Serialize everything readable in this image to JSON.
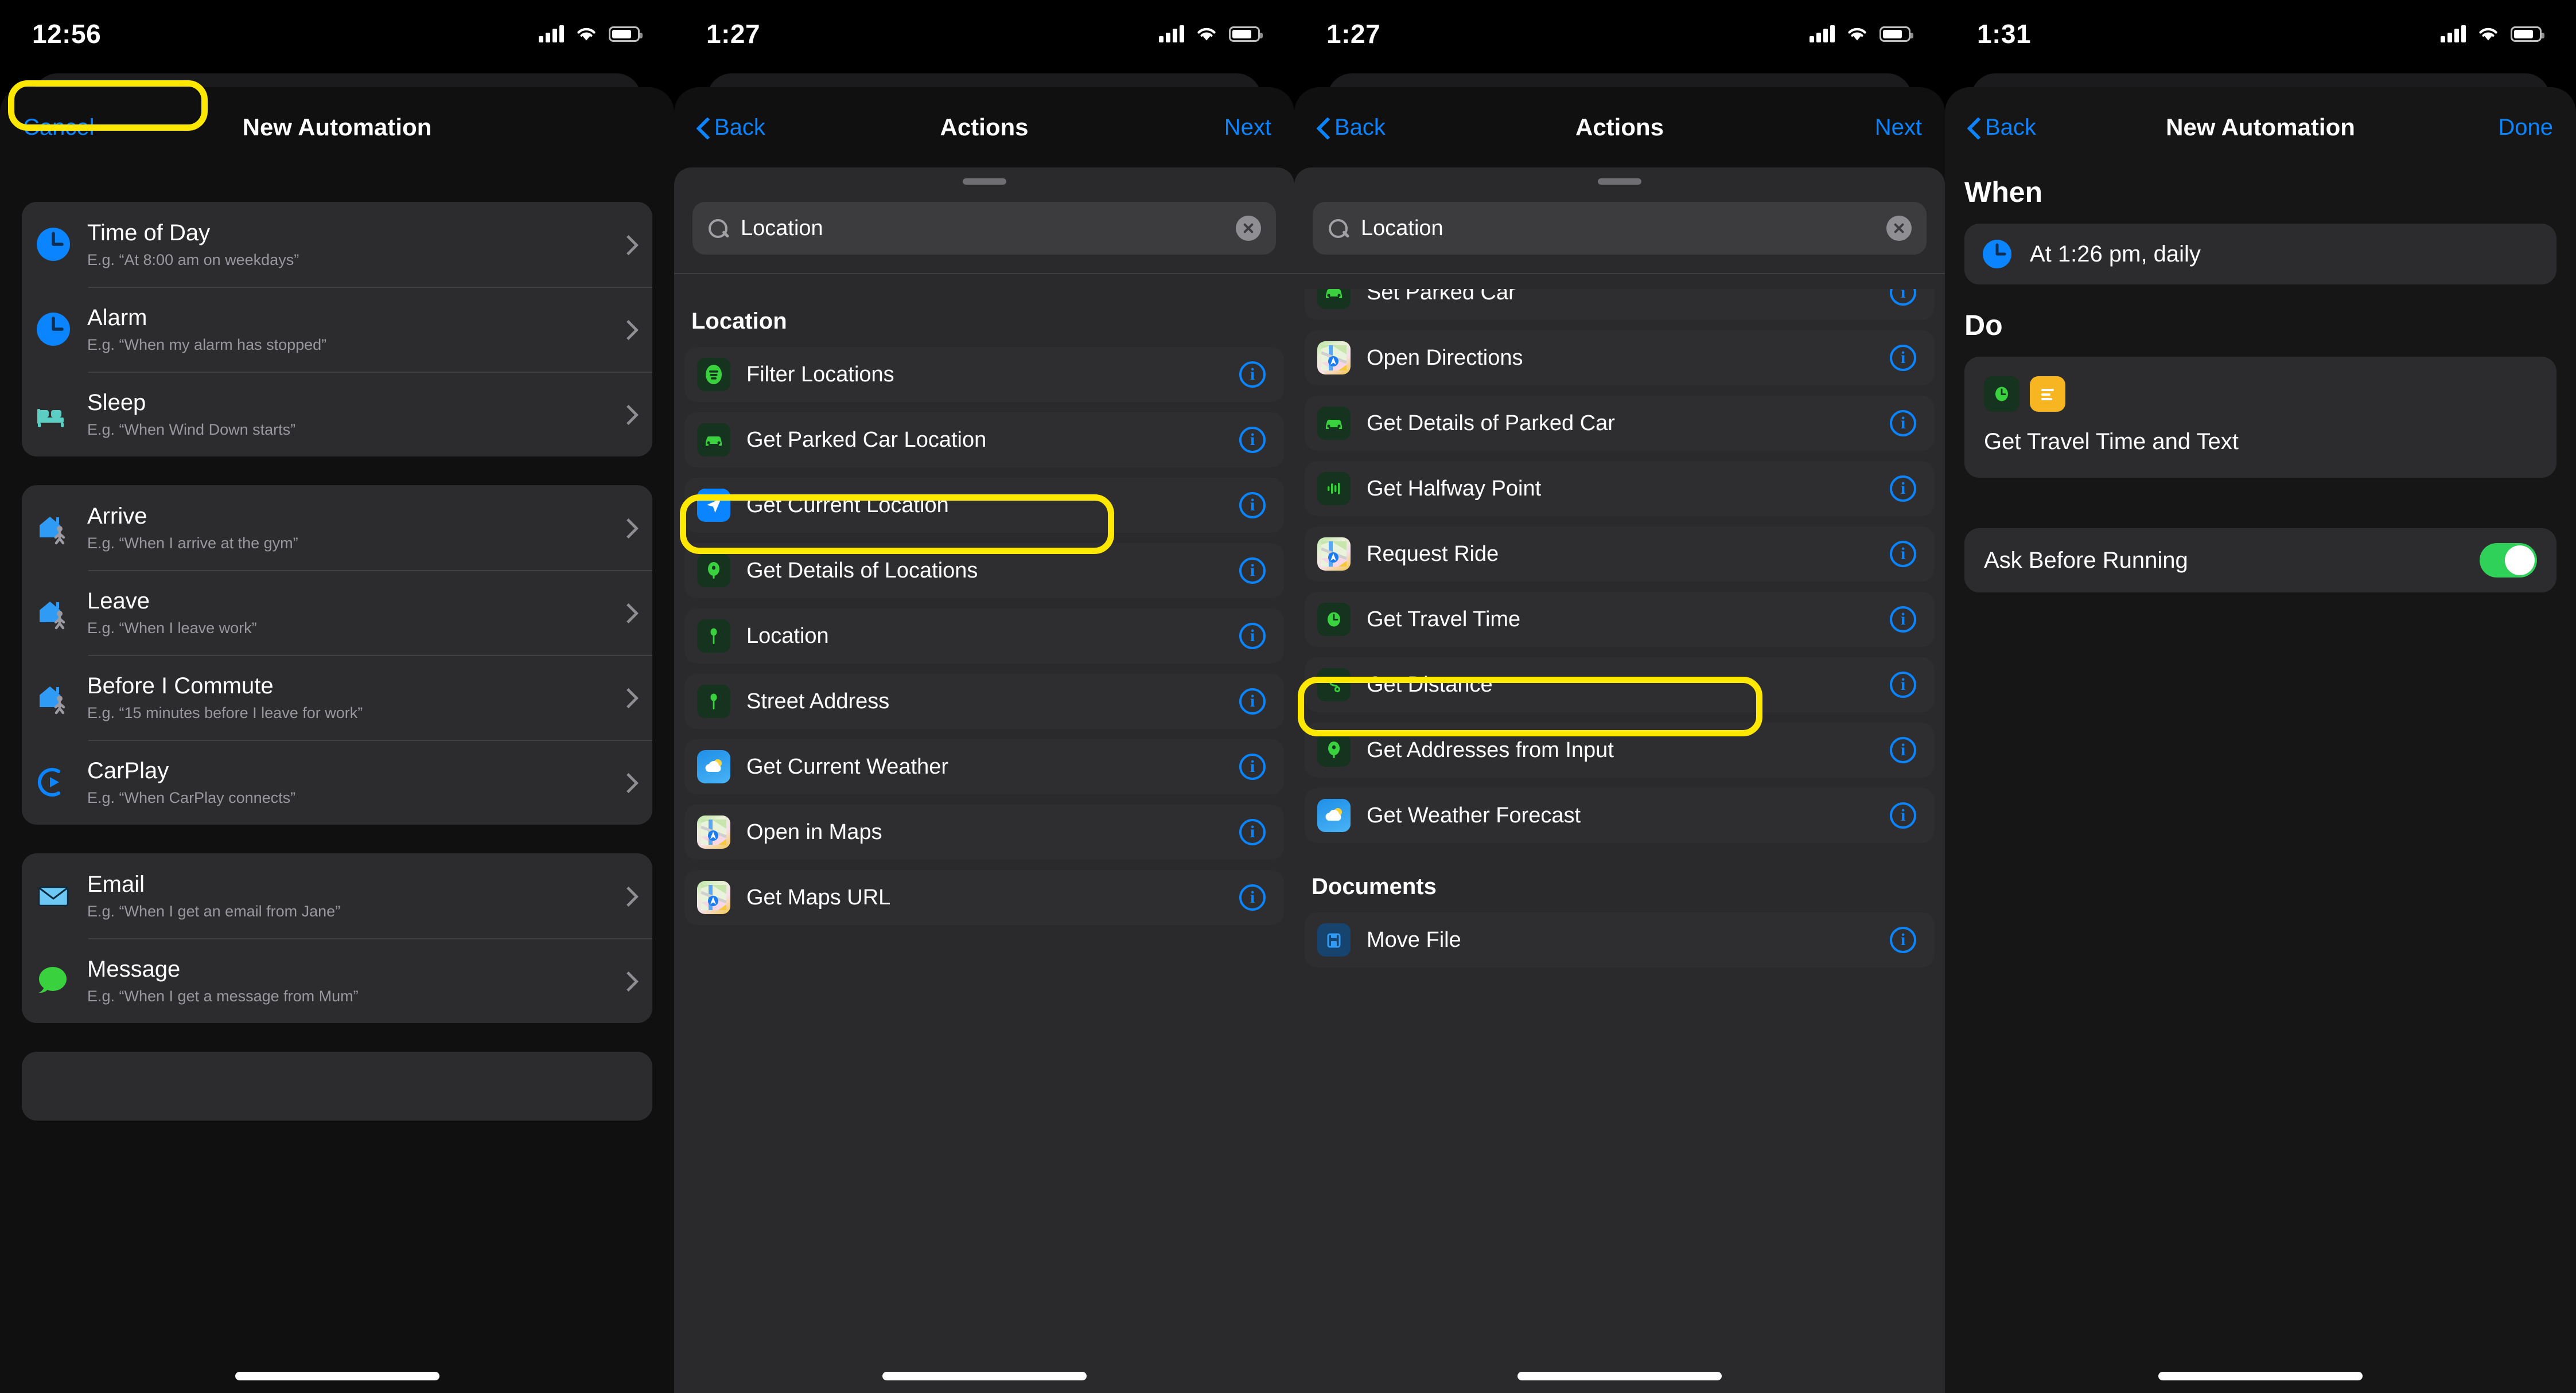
{
  "screens": [
    {
      "id": "new-automation-trigger-picker",
      "status": {
        "time": "12:56"
      },
      "nav": {
        "left": "Cancel",
        "title": "New Automation",
        "right": ""
      },
      "groups": [
        {
          "items": [
            {
              "icon": "clock-icon",
              "title": "Time of Day",
              "subtitle": "E.g. “At 8:00 am on weekdays”",
              "highlighted": true
            },
            {
              "icon": "alarm-clock-icon",
              "title": "Alarm",
              "subtitle": "E.g. “When my alarm has stopped”",
              "highlighted": false
            },
            {
              "icon": "bed-icon",
              "title": "Sleep",
              "subtitle": "E.g. “When Wind Down starts”",
              "highlighted": false
            }
          ]
        },
        {
          "items": [
            {
              "icon": "house-walk-icon",
              "title": "Arrive",
              "subtitle": "E.g. “When I arrive at the gym”",
              "highlighted": false
            },
            {
              "icon": "house-walk-icon",
              "title": "Leave",
              "subtitle": "E.g. “When I leave work”",
              "highlighted": false
            },
            {
              "icon": "house-walk-icon",
              "title": "Before I Commute",
              "subtitle": "E.g. “15 minutes before I leave for work”",
              "highlighted": false
            },
            {
              "icon": "carplay-icon",
              "title": "CarPlay",
              "subtitle": "E.g. “When CarPlay connects”",
              "highlighted": false
            }
          ]
        },
        {
          "items": [
            {
              "icon": "envelope-icon",
              "title": "Email",
              "subtitle": "E.g. “When I get an email from Jane”",
              "highlighted": false
            },
            {
              "icon": "message-bubble-icon",
              "title": "Message",
              "subtitle": "E.g. “When I get a message from Mum”",
              "highlighted": false
            }
          ]
        }
      ]
    },
    {
      "id": "actions-search-top",
      "status": {
        "time": "1:27"
      },
      "nav": {
        "left": "Back",
        "title": "Actions",
        "right": "Next"
      },
      "search": {
        "value": "Location",
        "placeholder": "Search",
        "clear_label": "Clear"
      },
      "section_header": "Location",
      "actions": [
        {
          "icon": "filter-lines-icon",
          "tile": "t-green-dark",
          "label": "Filter Locations",
          "highlighted": false
        },
        {
          "icon": "car-icon",
          "tile": "t-green-dark",
          "label": "Get Parked Car Location",
          "highlighted": false
        },
        {
          "icon": "navigation-arrow-icon",
          "tile": "t-blue",
          "label": "Get Current Location",
          "highlighted": true
        },
        {
          "icon": "map-pin-icon",
          "tile": "t-green-dark",
          "label": "Get Details of Locations",
          "highlighted": false
        },
        {
          "icon": "map-pin-icon",
          "tile": "t-green-dark",
          "label": "Location",
          "highlighted": false
        },
        {
          "icon": "map-pin-icon",
          "tile": "t-green-dark",
          "label": "Street Address",
          "highlighted": false
        },
        {
          "icon": "weather-cloud-sun-icon",
          "tile": "t-weather",
          "label": "Get Current Weather",
          "highlighted": false
        },
        {
          "icon": "apple-maps-icon",
          "tile": "t-maps",
          "label": "Open in Maps",
          "highlighted": false
        },
        {
          "icon": "apple-maps-icon",
          "tile": "t-maps",
          "label": "Get Maps URL",
          "highlighted": false
        }
      ]
    },
    {
      "id": "actions-search-scrolled",
      "status": {
        "time": "1:27"
      },
      "nav": {
        "left": "Back",
        "title": "Actions",
        "right": "Next"
      },
      "search": {
        "value": "Location",
        "placeholder": "Search",
        "clear_label": "Clear"
      },
      "actions": [
        {
          "icon": "car-icon",
          "tile": "t-green-dark",
          "label": "Set Parked Car",
          "highlighted": false
        },
        {
          "icon": "apple-maps-icon",
          "tile": "t-maps",
          "label": "Open Directions",
          "highlighted": false
        },
        {
          "icon": "car-icon",
          "tile": "t-green-dark",
          "label": "Get Details of Parked Car",
          "highlighted": false
        },
        {
          "icon": "waveform-icon",
          "tile": "t-green-dark",
          "label": "Get Halfway Point",
          "highlighted": false
        },
        {
          "icon": "apple-maps-icon",
          "tile": "t-maps",
          "label": "Request Ride",
          "highlighted": false
        },
        {
          "icon": "clock-green-icon",
          "tile": "t-green-dark",
          "label": "Get Travel Time",
          "highlighted": true
        },
        {
          "icon": "route-icon",
          "tile": "t-green-dark",
          "label": "Get Distance",
          "highlighted": false
        },
        {
          "icon": "map-pin-icon",
          "tile": "t-green-dark",
          "label": "Get Addresses from Input",
          "highlighted": false
        },
        {
          "icon": "weather-cloud-sun-icon",
          "tile": "t-weather",
          "label": "Get Weather Forecast",
          "highlighted": false
        }
      ],
      "section_header_bottom": "Documents",
      "actions_bottom": [
        {
          "icon": "move-file-icon",
          "tile": "t-docblue",
          "label": "Move File",
          "highlighted": false
        }
      ]
    },
    {
      "id": "new-automation-summary",
      "status": {
        "time": "1:31"
      },
      "nav": {
        "left": "Back",
        "title": "New Automation",
        "right": "Done"
      },
      "when": {
        "heading": "When",
        "icon": "clock-icon",
        "text": "At 1:26 pm, daily"
      },
      "do": {
        "heading": "Do",
        "icons": [
          "clock-green-icon",
          "text-lines-icon"
        ],
        "label": "Get Travel Time and Text"
      },
      "ask_before_running": {
        "label": "Ask Before Running",
        "value": "on"
      }
    }
  ],
  "colors": {
    "accent_blue": "#0a84ff",
    "highlight_yellow": "#ffe800",
    "toggle_green": "#30d158",
    "card_bg": "#2c2c2e",
    "sheet_bg": "#101011"
  }
}
